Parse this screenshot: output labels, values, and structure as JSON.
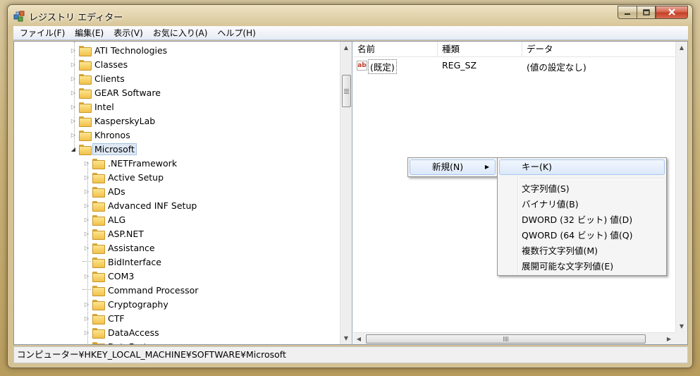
{
  "window": {
    "title": "レジストリ エディター",
    "icons": {
      "app": "regedit-cubes-icon",
      "minimize": "minimize-icon",
      "maximize": "maximize-icon",
      "close": "close-icon"
    }
  },
  "menubar": [
    {
      "label": "ファイル(F)"
    },
    {
      "label": "編集(E)"
    },
    {
      "label": "表示(V)"
    },
    {
      "label": "お気に入り(A)"
    },
    {
      "label": "ヘルプ(H)"
    }
  ],
  "tree": {
    "nodes": [
      {
        "label": "ATI Technologies",
        "level": 0,
        "expander": "collapsed"
      },
      {
        "label": "Classes",
        "level": 0,
        "expander": "collapsed"
      },
      {
        "label": "Clients",
        "level": 0,
        "expander": "collapsed"
      },
      {
        "label": "GEAR Software",
        "level": 0,
        "expander": "collapsed"
      },
      {
        "label": "Intel",
        "level": 0,
        "expander": "collapsed"
      },
      {
        "label": "KasperskyLab",
        "level": 0,
        "expander": "collapsed"
      },
      {
        "label": "Khronos",
        "level": 0,
        "expander": "collapsed"
      },
      {
        "label": "Microsoft",
        "level": 0,
        "expander": "expanded",
        "selected": true
      },
      {
        "label": ".NETFramework",
        "level": 1,
        "expander": "collapsed"
      },
      {
        "label": "Active Setup",
        "level": 1,
        "expander": "collapsed"
      },
      {
        "label": "ADs",
        "level": 1,
        "expander": "collapsed"
      },
      {
        "label": "Advanced INF Setup",
        "level": 1,
        "expander": "collapsed"
      },
      {
        "label": "ALG",
        "level": 1,
        "expander": "collapsed"
      },
      {
        "label": "ASP.NET",
        "level": 1,
        "expander": "collapsed"
      },
      {
        "label": "Assistance",
        "level": 1,
        "expander": "collapsed"
      },
      {
        "label": "BidInterface",
        "level": 1,
        "expander": "none"
      },
      {
        "label": "COM3",
        "level": 1,
        "expander": "collapsed"
      },
      {
        "label": "Command Processor",
        "level": 1,
        "expander": "none"
      },
      {
        "label": "Cryptography",
        "level": 1,
        "expander": "collapsed"
      },
      {
        "label": "CTF",
        "level": 1,
        "expander": "collapsed"
      },
      {
        "label": "DataAccess",
        "level": 1,
        "expander": "collapsed"
      },
      {
        "label": "DataFactory",
        "level": 1,
        "expander": "collapsed"
      }
    ]
  },
  "list": {
    "columns": [
      "名前",
      "種類",
      "データ"
    ],
    "rows": [
      {
        "icon": "string-value-ab-icon",
        "name": "(既定)",
        "type": "REG_SZ",
        "data": "(値の設定なし)"
      }
    ]
  },
  "context_menu": {
    "new_item": "新規(N)",
    "submenu": {
      "key": "キー(K)",
      "items": [
        "文字列値(S)",
        "バイナリ値(B)",
        "DWORD (32 ビット) 値(D)",
        "QWORD (64 ビット) 値(Q)",
        "複数行文字列値(M)",
        "展開可能な文字列値(E)"
      ]
    }
  },
  "statusbar": {
    "path": "コンピューター¥HKEY_LOCAL_MACHINE¥SOFTWARE¥Microsoft"
  }
}
